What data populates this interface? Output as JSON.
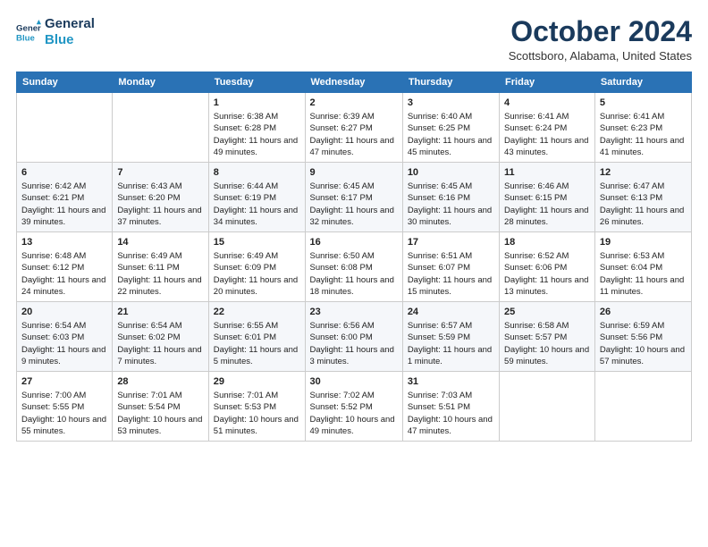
{
  "header": {
    "logo_line1": "General",
    "logo_line2": "Blue",
    "month": "October 2024",
    "location": "Scottsboro, Alabama, United States"
  },
  "weekdays": [
    "Sunday",
    "Monday",
    "Tuesday",
    "Wednesday",
    "Thursday",
    "Friday",
    "Saturday"
  ],
  "weeks": [
    [
      {
        "day": "",
        "info": ""
      },
      {
        "day": "",
        "info": ""
      },
      {
        "day": "1",
        "info": "Sunrise: 6:38 AM\nSunset: 6:28 PM\nDaylight: 11 hours and 49 minutes."
      },
      {
        "day": "2",
        "info": "Sunrise: 6:39 AM\nSunset: 6:27 PM\nDaylight: 11 hours and 47 minutes."
      },
      {
        "day": "3",
        "info": "Sunrise: 6:40 AM\nSunset: 6:25 PM\nDaylight: 11 hours and 45 minutes."
      },
      {
        "day": "4",
        "info": "Sunrise: 6:41 AM\nSunset: 6:24 PM\nDaylight: 11 hours and 43 minutes."
      },
      {
        "day": "5",
        "info": "Sunrise: 6:41 AM\nSunset: 6:23 PM\nDaylight: 11 hours and 41 minutes."
      }
    ],
    [
      {
        "day": "6",
        "info": "Sunrise: 6:42 AM\nSunset: 6:21 PM\nDaylight: 11 hours and 39 minutes."
      },
      {
        "day": "7",
        "info": "Sunrise: 6:43 AM\nSunset: 6:20 PM\nDaylight: 11 hours and 37 minutes."
      },
      {
        "day": "8",
        "info": "Sunrise: 6:44 AM\nSunset: 6:19 PM\nDaylight: 11 hours and 34 minutes."
      },
      {
        "day": "9",
        "info": "Sunrise: 6:45 AM\nSunset: 6:17 PM\nDaylight: 11 hours and 32 minutes."
      },
      {
        "day": "10",
        "info": "Sunrise: 6:45 AM\nSunset: 6:16 PM\nDaylight: 11 hours and 30 minutes."
      },
      {
        "day": "11",
        "info": "Sunrise: 6:46 AM\nSunset: 6:15 PM\nDaylight: 11 hours and 28 minutes."
      },
      {
        "day": "12",
        "info": "Sunrise: 6:47 AM\nSunset: 6:13 PM\nDaylight: 11 hours and 26 minutes."
      }
    ],
    [
      {
        "day": "13",
        "info": "Sunrise: 6:48 AM\nSunset: 6:12 PM\nDaylight: 11 hours and 24 minutes."
      },
      {
        "day": "14",
        "info": "Sunrise: 6:49 AM\nSunset: 6:11 PM\nDaylight: 11 hours and 22 minutes."
      },
      {
        "day": "15",
        "info": "Sunrise: 6:49 AM\nSunset: 6:09 PM\nDaylight: 11 hours and 20 minutes."
      },
      {
        "day": "16",
        "info": "Sunrise: 6:50 AM\nSunset: 6:08 PM\nDaylight: 11 hours and 18 minutes."
      },
      {
        "day": "17",
        "info": "Sunrise: 6:51 AM\nSunset: 6:07 PM\nDaylight: 11 hours and 15 minutes."
      },
      {
        "day": "18",
        "info": "Sunrise: 6:52 AM\nSunset: 6:06 PM\nDaylight: 11 hours and 13 minutes."
      },
      {
        "day": "19",
        "info": "Sunrise: 6:53 AM\nSunset: 6:04 PM\nDaylight: 11 hours and 11 minutes."
      }
    ],
    [
      {
        "day": "20",
        "info": "Sunrise: 6:54 AM\nSunset: 6:03 PM\nDaylight: 11 hours and 9 minutes."
      },
      {
        "day": "21",
        "info": "Sunrise: 6:54 AM\nSunset: 6:02 PM\nDaylight: 11 hours and 7 minutes."
      },
      {
        "day": "22",
        "info": "Sunrise: 6:55 AM\nSunset: 6:01 PM\nDaylight: 11 hours and 5 minutes."
      },
      {
        "day": "23",
        "info": "Sunrise: 6:56 AM\nSunset: 6:00 PM\nDaylight: 11 hours and 3 minutes."
      },
      {
        "day": "24",
        "info": "Sunrise: 6:57 AM\nSunset: 5:59 PM\nDaylight: 11 hours and 1 minute."
      },
      {
        "day": "25",
        "info": "Sunrise: 6:58 AM\nSunset: 5:57 PM\nDaylight: 10 hours and 59 minutes."
      },
      {
        "day": "26",
        "info": "Sunrise: 6:59 AM\nSunset: 5:56 PM\nDaylight: 10 hours and 57 minutes."
      }
    ],
    [
      {
        "day": "27",
        "info": "Sunrise: 7:00 AM\nSunset: 5:55 PM\nDaylight: 10 hours and 55 minutes."
      },
      {
        "day": "28",
        "info": "Sunrise: 7:01 AM\nSunset: 5:54 PM\nDaylight: 10 hours and 53 minutes."
      },
      {
        "day": "29",
        "info": "Sunrise: 7:01 AM\nSunset: 5:53 PM\nDaylight: 10 hours and 51 minutes."
      },
      {
        "day": "30",
        "info": "Sunrise: 7:02 AM\nSunset: 5:52 PM\nDaylight: 10 hours and 49 minutes."
      },
      {
        "day": "31",
        "info": "Sunrise: 7:03 AM\nSunset: 5:51 PM\nDaylight: 10 hours and 47 minutes."
      },
      {
        "day": "",
        "info": ""
      },
      {
        "day": "",
        "info": ""
      }
    ]
  ]
}
